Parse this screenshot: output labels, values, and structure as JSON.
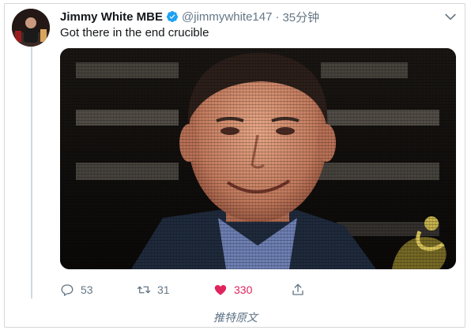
{
  "tweet": {
    "display_name": "Jimmy White MBE",
    "verified": true,
    "handle": "@jimmywhite147",
    "separator": "·",
    "time": "35分钟",
    "text": "Got there in the end crucible",
    "media_description": "Screen photo of man smiling",
    "actions": {
      "reply_count": "53",
      "retweet_count": "31",
      "like_count": "330",
      "liked": true
    }
  },
  "footer": {
    "view_original_label": "推特原文"
  },
  "colors": {
    "like_active": "#e0245e",
    "verified_badge": "#1da1f2",
    "muted_text": "#657786",
    "thread_line": "#cfd9de"
  },
  "icons": {
    "reply": "reply-icon",
    "retweet": "retweet-icon",
    "like": "heart-icon",
    "share": "share-icon",
    "more": "chevron-down-icon",
    "verified": "verified-badge-icon"
  }
}
